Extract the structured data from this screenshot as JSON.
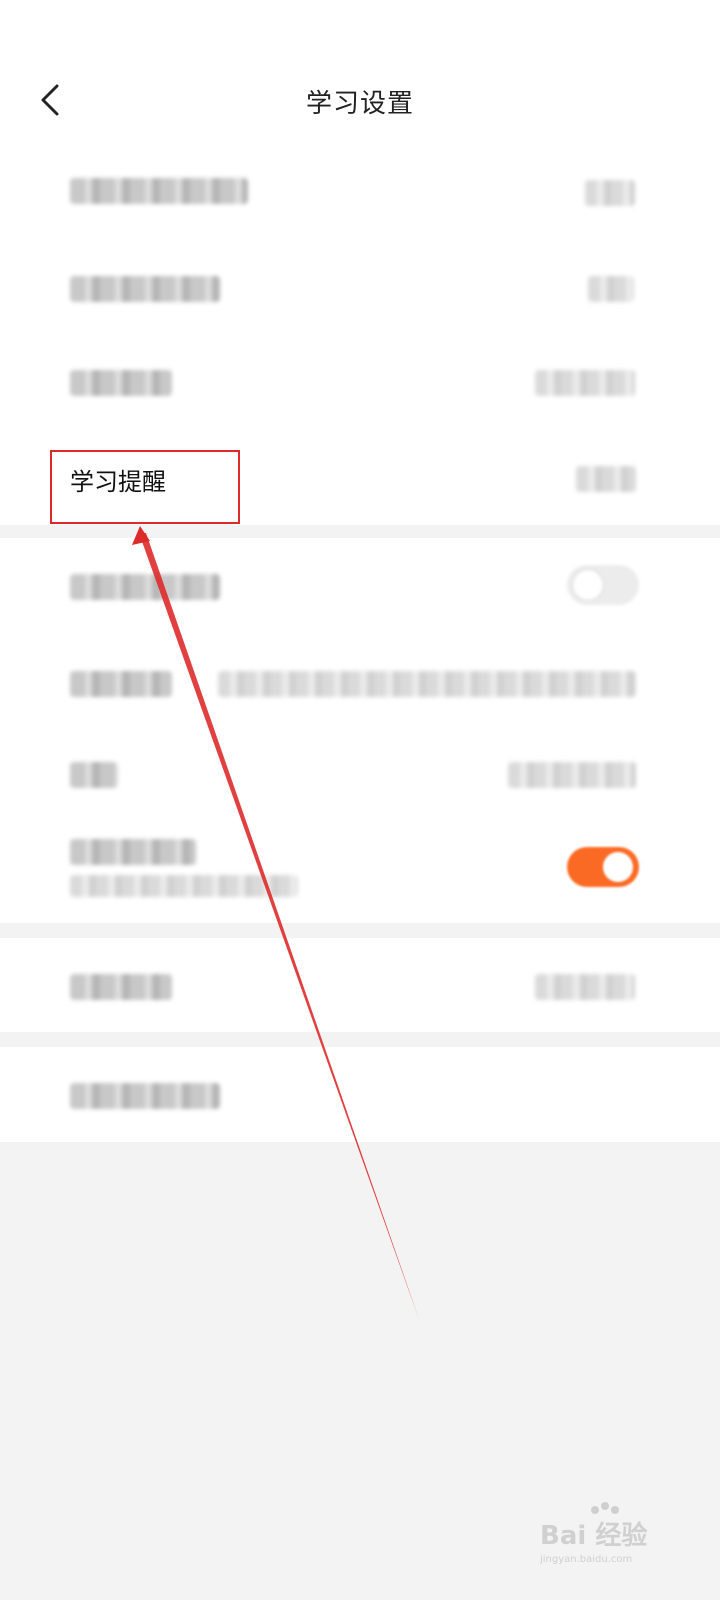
{
  "header": {
    "title": "学习设置",
    "back_icon": "chevron-left-icon"
  },
  "settings": {
    "highlighted_item_label": "学习提醒"
  },
  "colors": {
    "accent": "#fb6a25",
    "annotation": "#dd2b2b",
    "background": "#f3f3f3"
  },
  "toggles": {
    "first_toggle_on": false,
    "second_toggle_on": true
  },
  "watermark": {
    "logo": "baidu-jingyan-logo",
    "text": "Bai 经验",
    "url_text": "jingyan.baidu.com"
  }
}
